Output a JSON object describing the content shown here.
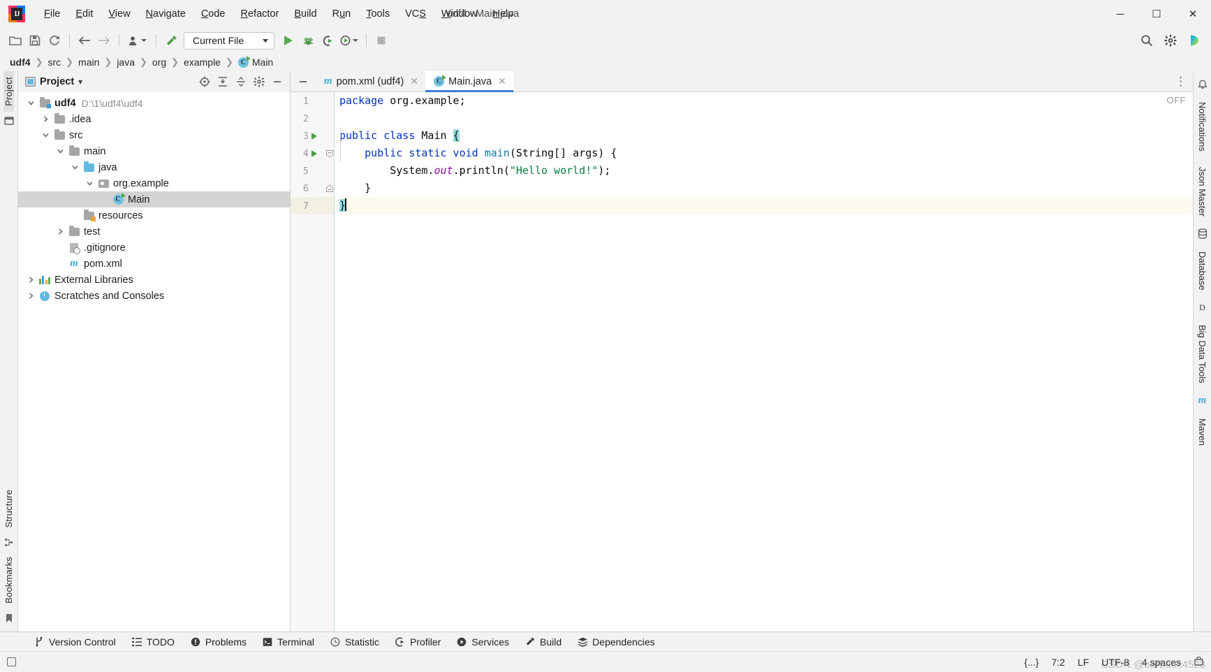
{
  "window": {
    "title": "udf4 - Main.java",
    "logo_text": "IJ",
    "minimize": "─",
    "maximize": "☐",
    "close": "✕"
  },
  "menu": [
    {
      "name": "file",
      "pre": "",
      "mn": "F",
      "post": "ile"
    },
    {
      "name": "edit",
      "pre": "",
      "mn": "E",
      "post": "dit"
    },
    {
      "name": "view",
      "pre": "",
      "mn": "V",
      "post": "iew"
    },
    {
      "name": "navigate",
      "pre": "",
      "mn": "N",
      "post": "avigate"
    },
    {
      "name": "code",
      "pre": "",
      "mn": "C",
      "post": "ode"
    },
    {
      "name": "refactor",
      "pre": "",
      "mn": "R",
      "post": "efactor"
    },
    {
      "name": "build",
      "pre": "",
      "mn": "B",
      "post": "uild"
    },
    {
      "name": "run",
      "pre": "R",
      "mn": "u",
      "post": "n"
    },
    {
      "name": "tools",
      "pre": "",
      "mn": "T",
      "post": "ools"
    },
    {
      "name": "vcs",
      "pre": "VC",
      "mn": "S",
      "post": ""
    },
    {
      "name": "window",
      "pre": "",
      "mn": "W",
      "post": "indow"
    },
    {
      "name": "help",
      "pre": "",
      "mn": "H",
      "post": "elp"
    }
  ],
  "toolbar": {
    "icons": [
      "open-folder-icon",
      "save-all-icon",
      "sync-refresh-icon",
      "back-arrow-icon",
      "forward-arrow-icon",
      "profile-dropdown-icon",
      "build-hammer-icon"
    ],
    "run_config": "Current File",
    "run_label": "Run",
    "debug_label": "Debug",
    "coverage_label": "Run with Coverage",
    "profile_label": "Profile",
    "stop_label": "Stop",
    "search_label": "Search Everywhere",
    "settings_label": "Settings",
    "updates_label": "IDE Services"
  },
  "breadcrumb": [
    {
      "label": "udf4",
      "bold": true,
      "icon": ""
    },
    {
      "label": "src",
      "bold": false,
      "icon": ""
    },
    {
      "label": "main",
      "bold": false,
      "icon": ""
    },
    {
      "label": "java",
      "bold": false,
      "icon": ""
    },
    {
      "label": "org",
      "bold": false,
      "icon": ""
    },
    {
      "label": "example",
      "bold": false,
      "icon": ""
    },
    {
      "label": "Main",
      "bold": false,
      "icon": "class-icon"
    }
  ],
  "breadcrumb_sep": "❯",
  "left_strip": {
    "tabs": [
      {
        "label": "Project",
        "active": true
      }
    ],
    "bottom_tabs": [
      {
        "label": "Structure"
      },
      {
        "label": "Bookmarks"
      }
    ]
  },
  "project_panel": {
    "title": "Project",
    "dropdown": "▾",
    "icons": [
      {
        "name": "select-opened-file-icon",
        "tooltip": "Select Opened File"
      },
      {
        "name": "expand-all-icon",
        "tooltip": "Expand All"
      },
      {
        "name": "collapse-all-icon",
        "tooltip": "Collapse All"
      },
      {
        "name": "gear-icon",
        "tooltip": "Options"
      },
      {
        "name": "hide-icon",
        "tooltip": "Hide"
      }
    ],
    "tree": [
      {
        "label": "udf4",
        "path": "D:\\1\\udf4\\udf4",
        "indent": 0,
        "arrow": "down",
        "icon": "project-folder",
        "bold": true,
        "selected": false
      },
      {
        "label": ".idea",
        "path": "",
        "indent": 1,
        "arrow": "right",
        "icon": "folder",
        "bold": false,
        "selected": false
      },
      {
        "label": "src",
        "path": "",
        "indent": 1,
        "arrow": "down",
        "icon": "folder",
        "bold": false,
        "selected": false
      },
      {
        "label": "main",
        "path": "",
        "indent": 2,
        "arrow": "down",
        "icon": "folder",
        "bold": false,
        "selected": false
      },
      {
        "label": "java",
        "path": "",
        "indent": 3,
        "arrow": "down",
        "icon": "source-folder",
        "bold": false,
        "selected": false
      },
      {
        "label": "org.example",
        "path": "",
        "indent": 4,
        "arrow": "down",
        "icon": "package",
        "bold": false,
        "selected": false
      },
      {
        "label": "Main",
        "path": "",
        "indent": 5,
        "arrow": "none",
        "icon": "class",
        "bold": false,
        "selected": true
      },
      {
        "label": "resources",
        "path": "",
        "indent": 3,
        "arrow": "none",
        "icon": "resource-folder",
        "bold": false,
        "selected": false
      },
      {
        "label": "test",
        "path": "",
        "indent": 2,
        "arrow": "right",
        "icon": "folder",
        "bold": false,
        "selected": false
      },
      {
        "label": ".gitignore",
        "path": "",
        "indent": 2,
        "arrow": "none",
        "icon": "ignored-file",
        "bold": false,
        "selected": false
      },
      {
        "label": "pom.xml",
        "path": "",
        "indent": 2,
        "arrow": "none",
        "icon": "maven",
        "bold": false,
        "selected": false
      },
      {
        "label": "External Libraries",
        "path": "",
        "indent": 0,
        "arrow": "right",
        "icon": "library",
        "bold": false,
        "selected": false
      },
      {
        "label": "Scratches and Consoles",
        "path": "",
        "indent": 0,
        "arrow": "right",
        "icon": "scratch",
        "bold": false,
        "selected": false
      }
    ]
  },
  "editor": {
    "tabs": [
      {
        "label": "pom.xml (udf4)",
        "icon": "maven-icon",
        "active": false,
        "close": "✕"
      },
      {
        "label": "Main.java",
        "icon": "class-icon",
        "active": true,
        "close": "✕"
      }
    ],
    "more_tabs": "⋮",
    "inspection_widget": "OFF",
    "lines": [
      {
        "n": "1",
        "runmark": false,
        "caret": false,
        "tokens": [
          {
            "t": "package ",
            "c": "kw"
          },
          {
            "t": "org.example;",
            "c": "plain"
          }
        ]
      },
      {
        "n": "2",
        "runmark": false,
        "caret": false,
        "tokens": []
      },
      {
        "n": "3",
        "runmark": true,
        "caret": false,
        "tokens": [
          {
            "t": "public class ",
            "c": "kw"
          },
          {
            "t": "Main ",
            "c": "plain"
          },
          {
            "t": "{",
            "c": "brace"
          }
        ]
      },
      {
        "n": "4",
        "runmark": true,
        "caret": false,
        "tokens": [
          {
            "t": "    ",
            "c": "plain"
          },
          {
            "t": "public static void ",
            "c": "kw"
          },
          {
            "t": "main",
            "c": "kw2"
          },
          {
            "t": "(String[] args) {",
            "c": "plain"
          }
        ]
      },
      {
        "n": "5",
        "runmark": false,
        "caret": false,
        "tokens": [
          {
            "t": "        System.",
            "c": "plain"
          },
          {
            "t": "out",
            "c": "fld"
          },
          {
            "t": ".println(",
            "c": "plain"
          },
          {
            "t": "\"Hello world!\"",
            "c": "str"
          },
          {
            "t": ");",
            "c": "plain"
          }
        ]
      },
      {
        "n": "6",
        "runmark": false,
        "caret": false,
        "tokens": [
          {
            "t": "    }",
            "c": "plain"
          }
        ]
      },
      {
        "n": "7",
        "runmark": false,
        "caret": true,
        "tokens": [
          {
            "t": "}",
            "c": "brace"
          }
        ]
      }
    ]
  },
  "right_strip": {
    "tabs": [
      {
        "label": "Notifications",
        "icon": "bell-icon"
      },
      {
        "label": "Json Master",
        "icon": "json-icon"
      },
      {
        "label": "Database",
        "icon": "database-icon"
      },
      {
        "label": "Big Data Tools",
        "icon": "bigdata-icon"
      },
      {
        "label": "Maven",
        "icon": "maven-icon"
      }
    ]
  },
  "bottom_bar": [
    {
      "label": "Version Control",
      "icon": "branch-icon"
    },
    {
      "label": "TODO",
      "icon": "todo-list-icon"
    },
    {
      "label": "Problems",
      "icon": "warning-icon"
    },
    {
      "label": "Terminal",
      "icon": "terminal-icon"
    },
    {
      "label": "Statistic",
      "icon": "clock-icon"
    },
    {
      "label": "Profiler",
      "icon": "profiler-icon"
    },
    {
      "label": "Services",
      "icon": "services-play-icon"
    },
    {
      "label": "Build",
      "icon": "hammer-icon"
    },
    {
      "label": "Dependencies",
      "icon": "layers-icon"
    }
  ],
  "status_bar": {
    "left_icon": "show-tool-windows-icon",
    "indent_braces": "{...}",
    "caret_position": "7:2",
    "line_separator": "LF",
    "encoding": "UTF-8",
    "indent": "4 spaces",
    "lock_icon": "read-only-icon",
    "watermark": "CSDN @barbaoc4523"
  },
  "colors": {
    "accent": "#3b7dd8",
    "run_green": "#5ba854",
    "keyword_blue": "#0033b3",
    "string_green": "#087d3f",
    "field_purple": "#871094",
    "brace_highlight": "#93e0e3",
    "caret_row": "#fcfaef",
    "selection_gray": "#d4d4d4",
    "panel_bg": "#f2f2f2"
  }
}
